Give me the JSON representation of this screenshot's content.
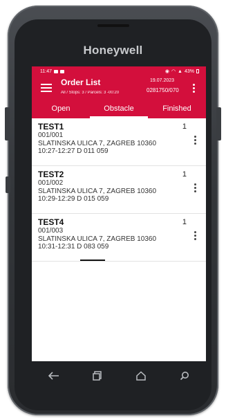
{
  "device": {
    "brand": "Honeywell"
  },
  "status_bar": {
    "time": "11:47",
    "battery": "43%"
  },
  "app_bar": {
    "title": "Order List",
    "subtitle": "All / Stops: 3 / Parcels: 3 -00:20",
    "date": "19.07.2023",
    "doc_number": "0281750/070"
  },
  "tabs": [
    {
      "label": "Open"
    },
    {
      "label": "Obstacle"
    },
    {
      "label": "Finished"
    }
  ],
  "selected_tab": "Obstacle",
  "orders": [
    {
      "name": "TEST1",
      "code": "001/001",
      "address": "SLATINSKA ULICA 7, ZAGREB 10360",
      "time": "10:27-12:27 D 011 059",
      "count": "1"
    },
    {
      "name": "TEST2",
      "code": "001/002",
      "address": "SLATINSKA ULICA 7, ZAGREB 10360",
      "time": "10:29-12:29 D 015 059",
      "count": "1"
    },
    {
      "name": "TEST4",
      "code": "001/003",
      "address": "SLATINSKA ULICA 7, ZAGREB 10360",
      "time": "10:31-12:31 D 083 059",
      "count": "1"
    }
  ],
  "nav_icons": [
    "back-icon",
    "recents-icon",
    "home-icon",
    "search-icon"
  ],
  "colors": {
    "accent": "#d30f3c"
  }
}
